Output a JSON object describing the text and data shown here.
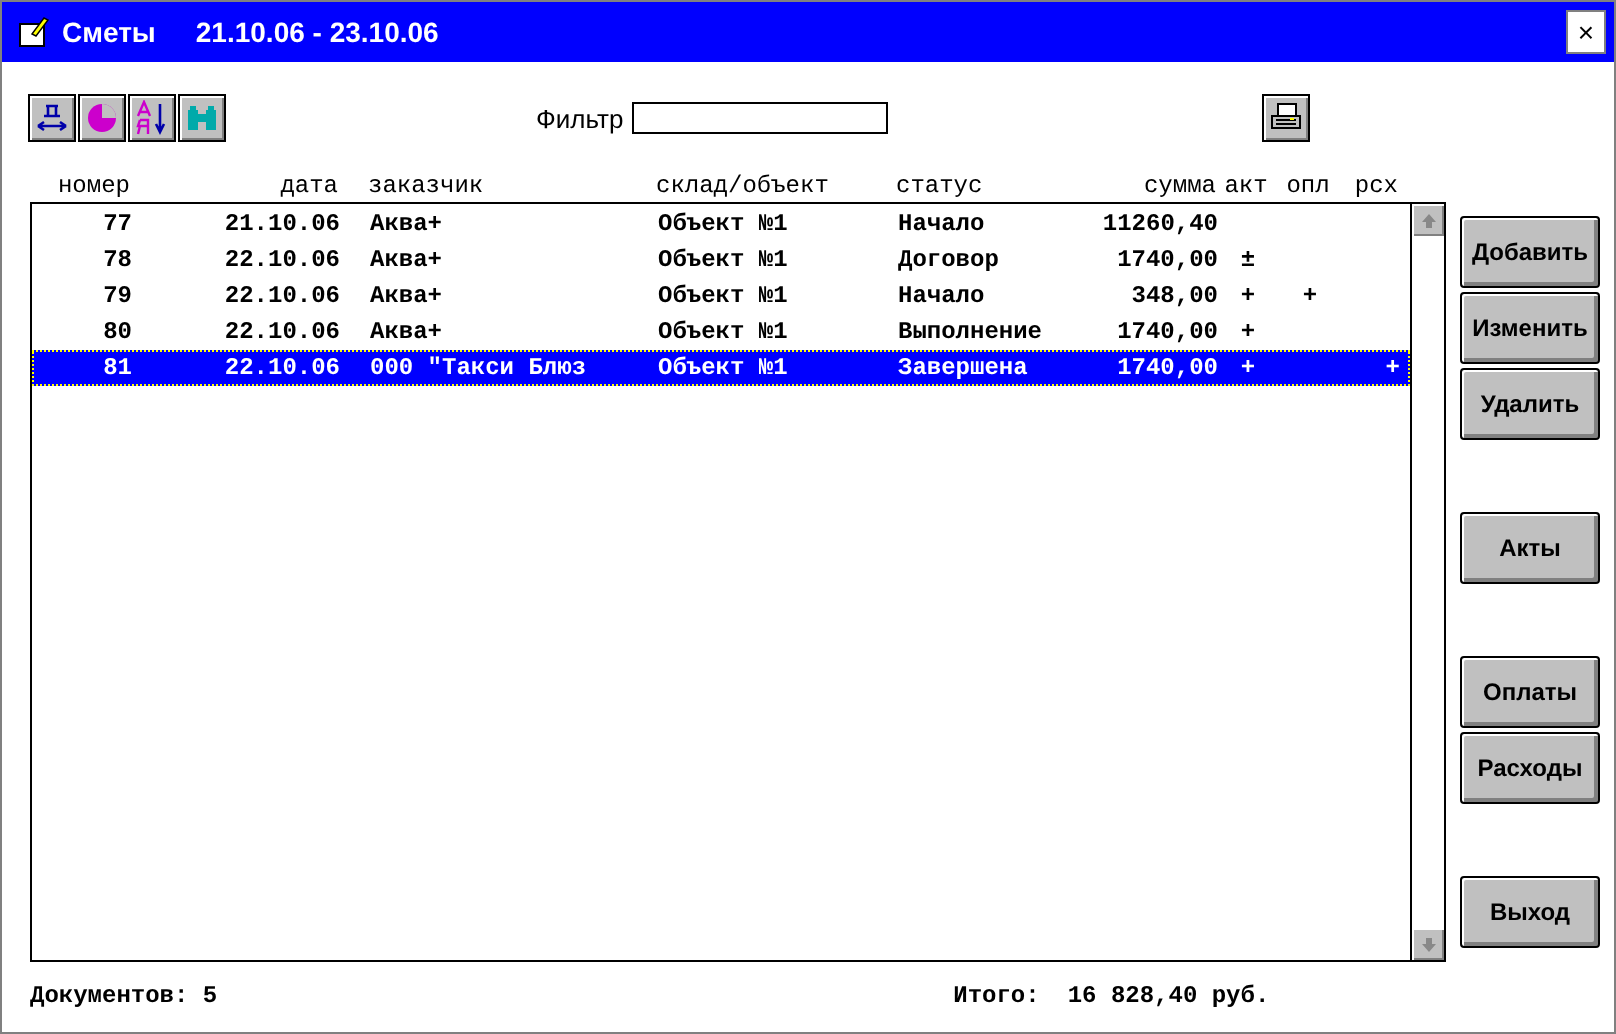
{
  "window": {
    "title": "Сметы",
    "period": "21.10.06 - 23.10.06",
    "close": "×"
  },
  "filter": {
    "label": "Фильтр"
  },
  "table": {
    "columns": [
      "номер",
      "дата",
      "заказчик",
      "склад/объект",
      "статус",
      "сумма",
      "акт",
      "опл",
      "рсх"
    ],
    "rows": [
      {
        "selected": false,
        "cells": [
          "77",
          "21.10.06",
          "Аква+",
          "Объект №1",
          "Начало",
          "11260,40",
          "",
          "",
          ""
        ]
      },
      {
        "selected": false,
        "cells": [
          "78",
          "22.10.06",
          "Аква+",
          "Объект №1",
          "Договор",
          "1740,00",
          "±",
          "",
          ""
        ]
      },
      {
        "selected": false,
        "cells": [
          "79",
          "22.10.06",
          "Аква+",
          "Объект №1",
          "Начало",
          "348,00",
          "+",
          "+",
          ""
        ]
      },
      {
        "selected": false,
        "cells": [
          "80",
          "22.10.06",
          "Аква+",
          "Объект №1",
          "Выполнение",
          "1740,00",
          "+",
          "",
          ""
        ]
      },
      {
        "selected": true,
        "cells": [
          "81",
          "22.10.06",
          "000 \"Такси Блюз",
          "Объект №1",
          "Завершена",
          "1740,00",
          "+",
          "",
          "+"
        ]
      }
    ]
  },
  "button_groups": [
    [
      "Добавить",
      "Изменить",
      "Удалить"
    ],
    [
      "Акты"
    ],
    [
      "Оплаты",
      "Расходы"
    ],
    [
      "Выход"
    ]
  ],
  "status_bar": {
    "documents": "Документов: 5",
    "total_label": "Итого:",
    "total": "16 828,40 руб."
  }
}
